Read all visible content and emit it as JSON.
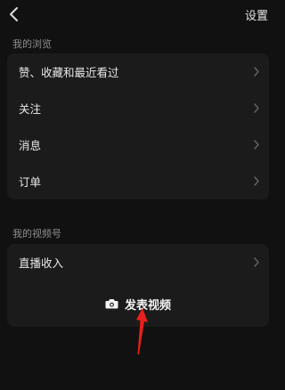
{
  "header": {
    "back_icon": "chevron-left-icon",
    "title": "设置"
  },
  "browse_section": {
    "title": "我的浏览",
    "items": [
      {
        "label": "赞、收藏和最近看过"
      },
      {
        "label": "关注"
      },
      {
        "label": "消息"
      },
      {
        "label": "订单"
      }
    ]
  },
  "channels_section": {
    "title": "我的视频号",
    "items": [
      {
        "label": "直播收入"
      }
    ],
    "publish": {
      "icon": "camera-icon",
      "label": "发表视频"
    }
  },
  "annotation": {
    "icon": "red-arrow-annotation",
    "color": "#e8201b"
  },
  "colors": {
    "background": "#111111",
    "card": "#1b1b1b",
    "text": "#e8e8e8",
    "muted": "#8e8e8e"
  }
}
